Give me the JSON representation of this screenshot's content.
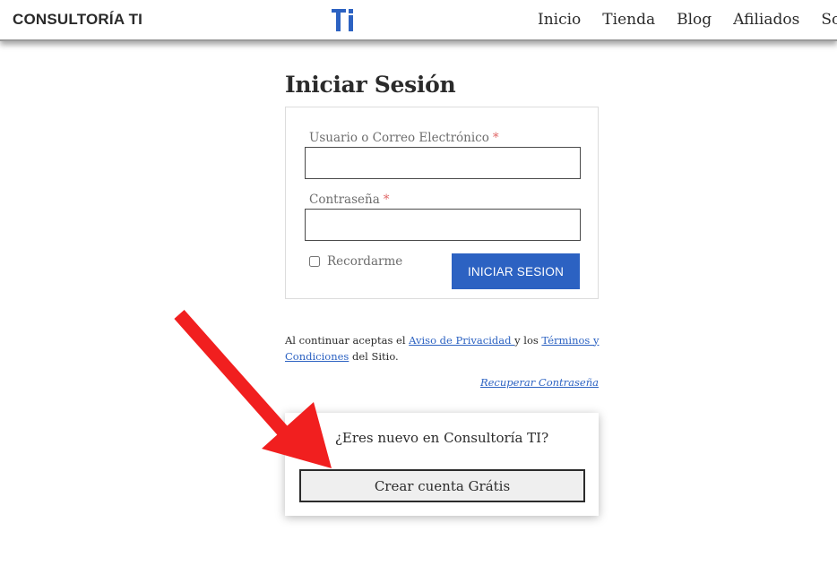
{
  "header": {
    "brand": "CONSULTORÍA TI",
    "logo_text": "TI",
    "nav": [
      "Inicio",
      "Tienda",
      "Blog",
      "Afiliados",
      "Soporte"
    ]
  },
  "login": {
    "title": "Iniciar Sesión",
    "username_label": "Usuario o Correo Electrónico",
    "password_label": "Contraseña",
    "required_mark": "*",
    "username_value": "",
    "password_value": "",
    "remember_label": "Recordarme",
    "remember_checked": false,
    "submit_label": "INICIAR SESION"
  },
  "legal": {
    "prefix": "Al continuar aceptas el ",
    "privacy_link": "Aviso de Privacidad ",
    "middle": "y los ",
    "terms_link": "Términos y Condiciones",
    "suffix": " del Sitio."
  },
  "recover_link": "Recuperar Contraseña",
  "register": {
    "question": "¿Eres nuevo en Consultoría TI?",
    "button_label": "Crear cuenta Grátis"
  },
  "colors": {
    "accent": "#2c62c2",
    "annotation_arrow": "#f11f1f"
  }
}
